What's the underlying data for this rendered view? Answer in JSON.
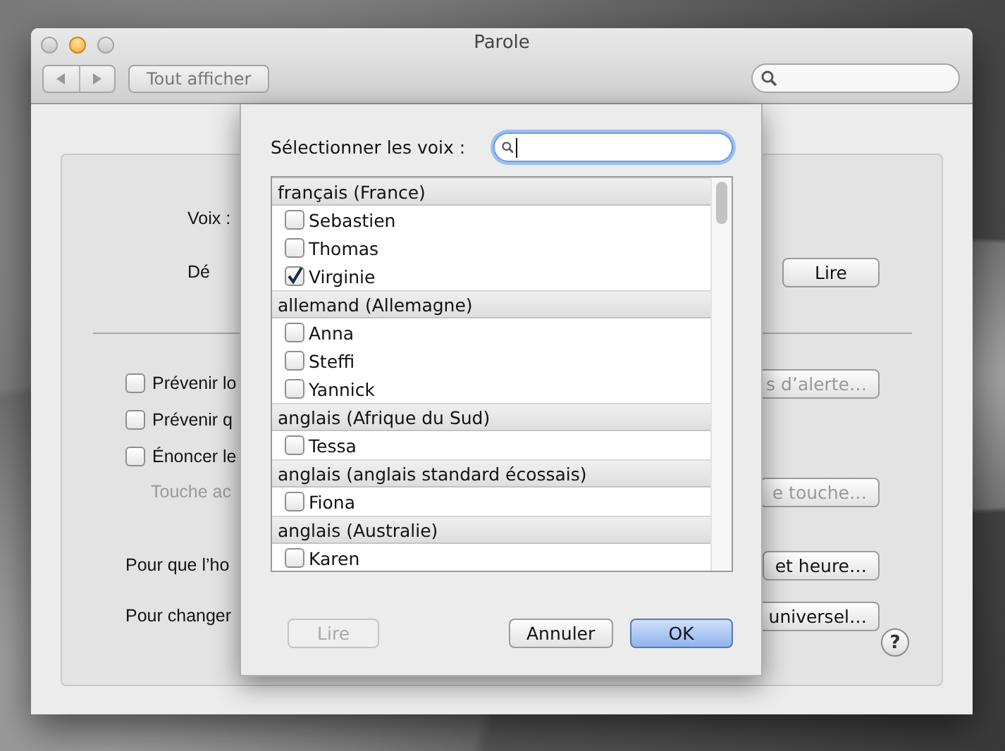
{
  "window": {
    "title": "Parole"
  },
  "toolbar": {
    "show_all_button": "Tout afficher"
  },
  "panel": {
    "sections": [
      {
        "rows": [
          {
            "kind": "label",
            "text": "Voix :"
          },
          {
            "kind": "label",
            "text": "Dé",
            "button": {
              "label": "Lire",
              "disabled": false
            }
          }
        ]
      },
      {
        "rows": [
          {
            "kind": "checkbox",
            "text": "Prévenir lo",
            "checked": false,
            "button": {
              "label": "s d’alerte…",
              "disabled": true
            }
          },
          {
            "kind": "checkbox",
            "text": "Prévenir q",
            "checked": false
          },
          {
            "kind": "checkbox",
            "text": "Énoncer le",
            "checked": false
          },
          {
            "kind": "hint",
            "text": "Touche ac",
            "button": {
              "label": "e touche…",
              "disabled": true
            }
          },
          {
            "kind": "spacer"
          },
          {
            "kind": "text",
            "text": "Pour que l’ho",
            "button": {
              "label": "et heure…",
              "disabled": false
            }
          },
          {
            "kind": "text",
            "text": "Pour changer",
            "button": {
              "label": "universel…",
              "disabled": false
            }
          }
        ]
      }
    ],
    "help_button": "?"
  },
  "sheet": {
    "label": "Sélectionner les voix :",
    "search": {
      "focused": true
    },
    "groups": [
      {
        "name": "français (France)",
        "voices": [
          {
            "name": "Sebastien",
            "checked": false
          },
          {
            "name": "Thomas",
            "checked": false
          },
          {
            "name": "Virginie",
            "checked": true
          }
        ]
      },
      {
        "name": "allemand (Allemagne)",
        "voices": [
          {
            "name": "Anna",
            "checked": false
          },
          {
            "name": "Steffi",
            "checked": false
          },
          {
            "name": "Yannick",
            "checked": false
          }
        ]
      },
      {
        "name": "anglais (Afrique du Sud)",
        "voices": [
          {
            "name": "Tessa",
            "checked": false
          }
        ]
      },
      {
        "name": "anglais (anglais standard écossais)",
        "voices": [
          {
            "name": "Fiona",
            "checked": false
          }
        ]
      },
      {
        "name": "anglais (Australie)",
        "voices": [
          {
            "name": "Karen",
            "checked": false
          }
        ]
      }
    ],
    "buttons": [
      {
        "label": "Lire",
        "disabled": true,
        "default": false
      },
      {
        "label": "Annuler",
        "disabled": false,
        "default": false
      },
      {
        "label": "OK",
        "disabled": false,
        "default": true
      }
    ]
  }
}
